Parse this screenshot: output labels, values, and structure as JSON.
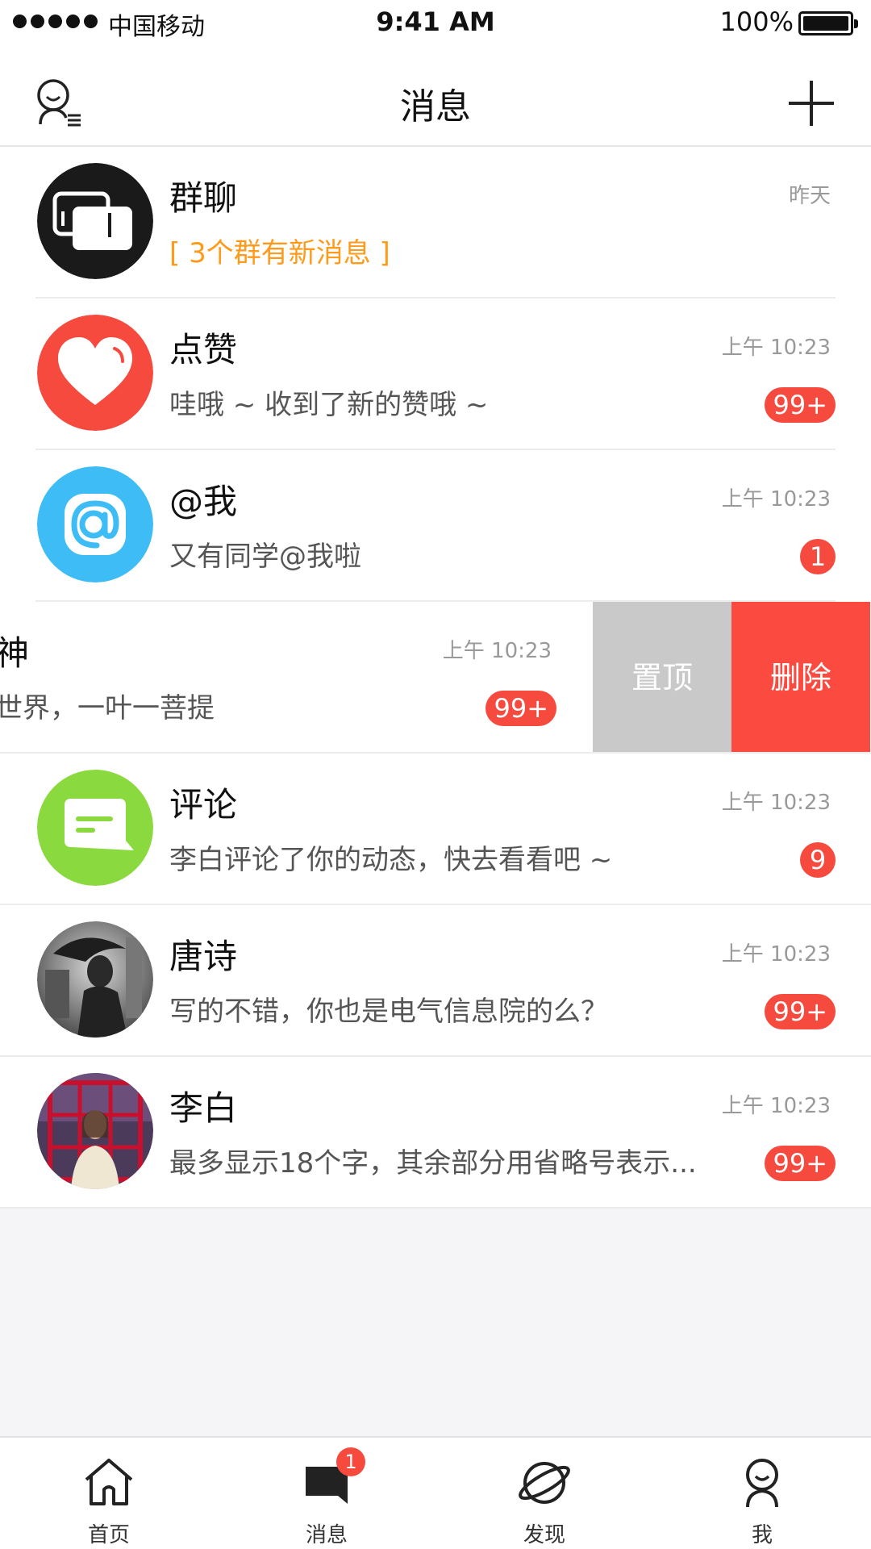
{
  "status_bar": {
    "carrier": "中国移动",
    "time": "9:41 AM",
    "battery": "100%"
  },
  "nav": {
    "title": "消息",
    "left_icon": "contacts-icon",
    "right_icon": "plus-icon"
  },
  "conversations": [
    {
      "name": "群聊",
      "message": "[ 3个群有新消息 ]",
      "time": "昨天",
      "badge": "",
      "avatar": "group-chat-icon",
      "color": "#1a1a1a"
    },
    {
      "name": "点赞",
      "message": "哇哦 ~ 收到了新的赞哦 ~",
      "time": "上午 10:23",
      "badge": "99+",
      "avatar": "heart-icon",
      "color": "#f64a3f"
    },
    {
      "name": "@我",
      "message": "又有同学@我啦",
      "time": "上午 10:23",
      "badge": "1",
      "avatar": "at-icon",
      "color": "#3dbcf6"
    },
    {
      "name": "神",
      "message": "世界，一叶一菩提",
      "time": "上午 10:23",
      "badge": "99+",
      "swiped": true
    },
    {
      "name": "评论",
      "message": "李白评论了你的动态，快去看看吧 ~",
      "time": "上午 10:23",
      "badge": "9",
      "avatar": "comment-icon",
      "color": "#8ad93f"
    },
    {
      "name": "唐诗",
      "message": "写的不错，你也是电气信息院的么？",
      "time": "上午 10:23",
      "badge": "99+",
      "avatar": "photo-avatar"
    },
    {
      "name": "李白",
      "message": "最多显示18个字，其余部分用省略号表示...",
      "time": "上午 10:23",
      "badge": "99+",
      "avatar": "photo-avatar"
    }
  ],
  "swipe_actions": {
    "pin": "置顶",
    "delete": "删除"
  },
  "tabs": [
    {
      "label": "首页",
      "icon": "home-icon",
      "badge": ""
    },
    {
      "label": "消息",
      "icon": "message-icon",
      "badge": "1"
    },
    {
      "label": "发现",
      "icon": "planet-icon",
      "badge": ""
    },
    {
      "label": "我",
      "icon": "person-icon",
      "badge": ""
    }
  ],
  "colors": {
    "accent": "#f64a3f",
    "orange": "#ff9a1a",
    "pin": "#c9c9c9"
  }
}
